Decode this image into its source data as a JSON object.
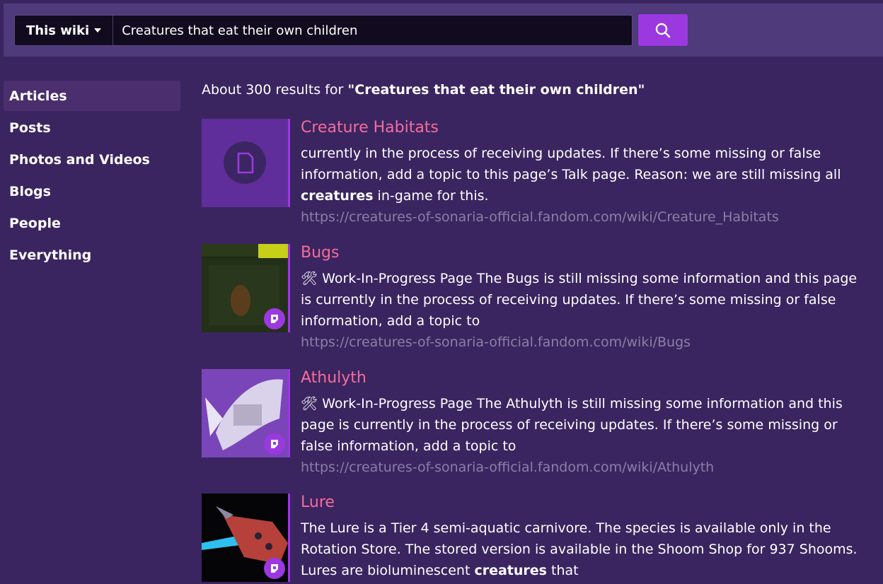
{
  "search": {
    "scope_label": "This wiki",
    "query": "Creatures that eat their own children"
  },
  "sidebar": {
    "items": [
      {
        "label": "Articles",
        "active": true
      },
      {
        "label": "Posts"
      },
      {
        "label": "Photos and Videos"
      },
      {
        "label": "Blogs"
      },
      {
        "label": "People"
      },
      {
        "label": "Everything"
      }
    ]
  },
  "summary": {
    "prefix": "About 300 results for ",
    "query_quoted": "\"Creatures that eat their own children\""
  },
  "results": [
    {
      "title": "Creature Habitats",
      "snippet_1": "currently in the process of receiving updates. If there’s some missing or false information, add a topic to this page’s Talk page. Reason: we are still missing all ",
      "snippet_bold": "creatures",
      "snippet_2": " in-game for this.",
      "url": "https://creatures-of-sonaria-official.fandom.com/wiki/Creature_Habitats"
    },
    {
      "title": "Bugs",
      "snippet_1": "🛠 Work-In-Progress Page The Bugs is still missing some information and this page is currently in the process of receiving updates. If there’s some missing or false information, add a topic to",
      "url": "https://creatures-of-sonaria-official.fandom.com/wiki/Bugs"
    },
    {
      "title": "Athulyth",
      "snippet_1": "🛠 Work-In-Progress Page The Athulyth is still missing some information and this page is currently in the process of receiving updates. If there’s some missing or false information, add a topic to",
      "url": "https://creatures-of-sonaria-official.fandom.com/wiki/Athulyth"
    },
    {
      "title": "Lure",
      "snippet_1": "The Lure is a Tier 4 semi-aquatic carnivore. The species is available only in the Rotation Store. The stored version is available in the Shoom Shop for 937 Shooms. Lures are bioluminescent ",
      "snippet_bold": "creatures",
      "snippet_2": " that"
    }
  ]
}
